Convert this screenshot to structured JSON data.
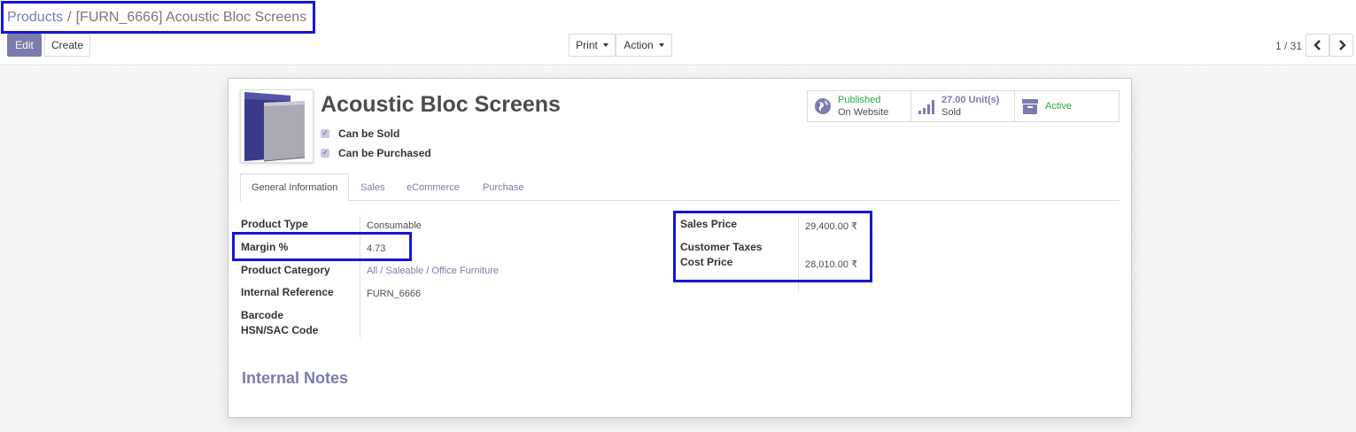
{
  "breadcrumb": {
    "parent": "Products",
    "separator": "/",
    "current": "[FURN_6666] Acoustic Bloc Screens"
  },
  "toolbar": {
    "edit_label": "Edit",
    "create_label": "Create",
    "print_label": "Print",
    "action_label": "Action"
  },
  "pager": {
    "value": "1 / 31"
  },
  "product": {
    "name": "Acoustic Bloc Screens",
    "can_be_sold_label": "Can be Sold",
    "can_be_purchased_label": "Can be Purchased"
  },
  "smart_buttons": {
    "published_status": "Published",
    "published_sub": "On Website",
    "sold_value": "27.00 Unit(s)",
    "sold_label": "Sold",
    "active_label": "Active"
  },
  "tabs": [
    "General Information",
    "Sales",
    "eCommerce",
    "Purchase"
  ],
  "general": {
    "product_type_label": "Product Type",
    "product_type_value": "Consumable",
    "margin_label": "Margin %",
    "margin_value": "4.73",
    "category_label": "Product Category",
    "category_value": "All / Saleable / Office Furniture",
    "internal_ref_label": "Internal Reference",
    "internal_ref_value": "FURN_6666",
    "barcode_label": "Barcode",
    "hsn_label": "HSN/SAC Code"
  },
  "pricing": {
    "sales_price_label": "Sales Price",
    "sales_price_value": "29,400.00 ₹",
    "customer_taxes_label": "Customer Taxes",
    "cost_price_label": "Cost Price",
    "cost_price_value": "28,010.00 ₹"
  },
  "notes": {
    "title": "Internal Notes"
  },
  "colors": {
    "accent": "#7c7bad",
    "highlight": "#1515d8",
    "active_green": "#28a745"
  }
}
